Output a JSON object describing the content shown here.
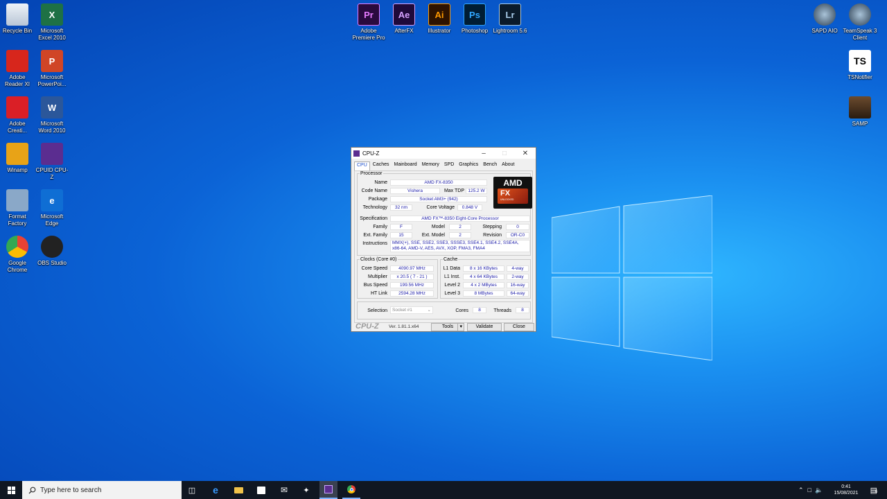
{
  "desktop": {
    "icons_left": [
      {
        "label": "Recycle Bin",
        "icon": "recycle-bin-icon",
        "color": "#cfd8e6"
      },
      {
        "label": "Microsoft Excel 2010",
        "icon": "excel-icon",
        "color": "#1e7145",
        "glyph": "X"
      },
      {
        "label": "Adobe Reader XI",
        "icon": "adobe-reader-icon",
        "color": "#d7261c"
      },
      {
        "label": "Microsoft PowerPoi...",
        "icon": "powerpoint-icon",
        "color": "#d04526",
        "glyph": "P"
      },
      {
        "label": "Adobe Creati...",
        "icon": "adobe-creative-cloud-icon",
        "color": "#da1f26"
      },
      {
        "label": "Microsoft Word 2010",
        "icon": "word-icon",
        "color": "#2b579a",
        "glyph": "W"
      },
      {
        "label": "Winamp",
        "icon": "winamp-icon",
        "color": "#e8a317"
      },
      {
        "label": "CPUID CPU-Z",
        "icon": "cpuz-icon",
        "color": "#5b2d90"
      },
      {
        "label": "Format Factory",
        "icon": "format-factory-icon",
        "color": "#8aa8c8"
      },
      {
        "label": "Microsoft Edge",
        "icon": "edge-icon",
        "color": "#0f6ed4",
        "glyph": "e"
      },
      {
        "label": "Google Chrome",
        "icon": "chrome-icon",
        "color": "#e94235"
      },
      {
        "label": "OBS Studio",
        "icon": "obs-icon",
        "color": "#222222"
      }
    ],
    "icons_top": [
      {
        "label": "Adobe Premiere Pro",
        "glyph": "Pr",
        "bg": "#2a0a3e",
        "fg": "#e77cff",
        "icon": "premiere-pro-icon"
      },
      {
        "label": "AfterFX",
        "glyph": "Ae",
        "bg": "#1f0a3a",
        "fg": "#d6a3ff",
        "icon": "after-effects-icon"
      },
      {
        "label": "Illustrator",
        "glyph": "Ai",
        "bg": "#2e1300",
        "fg": "#ff9a00",
        "icon": "illustrator-icon"
      },
      {
        "label": "Photoshop",
        "glyph": "Ps",
        "bg": "#001d34",
        "fg": "#31a8ff",
        "icon": "photoshop-icon"
      },
      {
        "label": "Lightroom 5.6",
        "glyph": "Lr",
        "bg": "#0a1a2a",
        "fg": "#a9cdeb",
        "icon": "lightroom-icon"
      }
    ],
    "icons_right": [
      {
        "label": "SAPD AIO",
        "icon": "sapd-aio-icon"
      },
      {
        "label": "TeamSpeak 3 Client",
        "icon": "teamspeak-icon"
      },
      {
        "label": "TSNotifier",
        "icon": "tsnotifier-icon",
        "glyph": "TS"
      },
      {
        "label": "SAMP",
        "icon": "samp-icon"
      }
    ]
  },
  "cpuz": {
    "title": "CPU-Z",
    "tabs": [
      "CPU",
      "Caches",
      "Mainboard",
      "Memory",
      "SPD",
      "Graphics",
      "Bench",
      "About"
    ],
    "processor": {
      "legend": "Processor",
      "name_label": "Name",
      "name": "AMD FX-8350",
      "codename_label": "Code Name",
      "codename": "Vishera",
      "maxtdp_label": "Max TDP",
      "maxtdp": "125.2 W",
      "package_label": "Package",
      "package": "Socket AM3+ (942)",
      "technology_label": "Technology",
      "technology": "32 nm",
      "corevoltage_label": "Core Voltage",
      "corevoltage": "0.848 V",
      "specification_label": "Specification",
      "specification": "AMD FX™-8350 Eight-Core Processor",
      "family_label": "Family",
      "family": "F",
      "model_label": "Model",
      "model": "2",
      "stepping_label": "Stepping",
      "stepping": "0",
      "extfamily_label": "Ext. Family",
      "extfamily": "15",
      "extmodel_label": "Ext. Model",
      "extmodel": "2",
      "revision_label": "Revision",
      "revision": "OR-C0",
      "instructions_label": "Instructions",
      "instructions_1": "MMX(+), SSE, SSE2, SSE3, SSSE3, SSE4.1, SSE4.2, SSE4A,",
      "instructions_2": "x86-64, AMD-V, AES, AVX, XOP, FMA3, FMA4",
      "logo_text": "AMD",
      "logo_sub": "FX",
      "logo_small": "UNLOCKED"
    },
    "clocks": {
      "legend": "Clocks (Core #0)",
      "corespeed_label": "Core Speed",
      "corespeed": "4090.97 MHz",
      "multiplier_label": "Multiplier",
      "multiplier": "x 20.5 ( 7 - 21 )",
      "busspeed_label": "Bus Speed",
      "busspeed": "199.56 MHz",
      "htlink_label": "HT Link",
      "htlink": "2594.28 MHz"
    },
    "cache": {
      "legend": "Cache",
      "rows": [
        {
          "label": "L1 Data",
          "size": "8 x 16 KBytes",
          "way": "4-way"
        },
        {
          "label": "L1 Inst.",
          "size": "4 x 64 KBytes",
          "way": "2-way"
        },
        {
          "label": "Level 2",
          "size": "4 x 2 MBytes",
          "way": "16-way"
        },
        {
          "label": "Level 3",
          "size": "8 MBytes",
          "way": "64-way"
        }
      ]
    },
    "selection_label": "Selection",
    "selection": "Socket #1",
    "cores_label": "Cores",
    "cores": "8",
    "threads_label": "Threads",
    "threads": "8",
    "brand": "CPU-Z",
    "version": "Ver. 1.81.1.x64",
    "tools_label": "Tools",
    "validate_label": "Validate",
    "close_label": "Close"
  },
  "taskbar": {
    "search_placeholder": "Type here to search",
    "time": "0:41",
    "date": "15/08/2021",
    "notification_count": "6"
  }
}
